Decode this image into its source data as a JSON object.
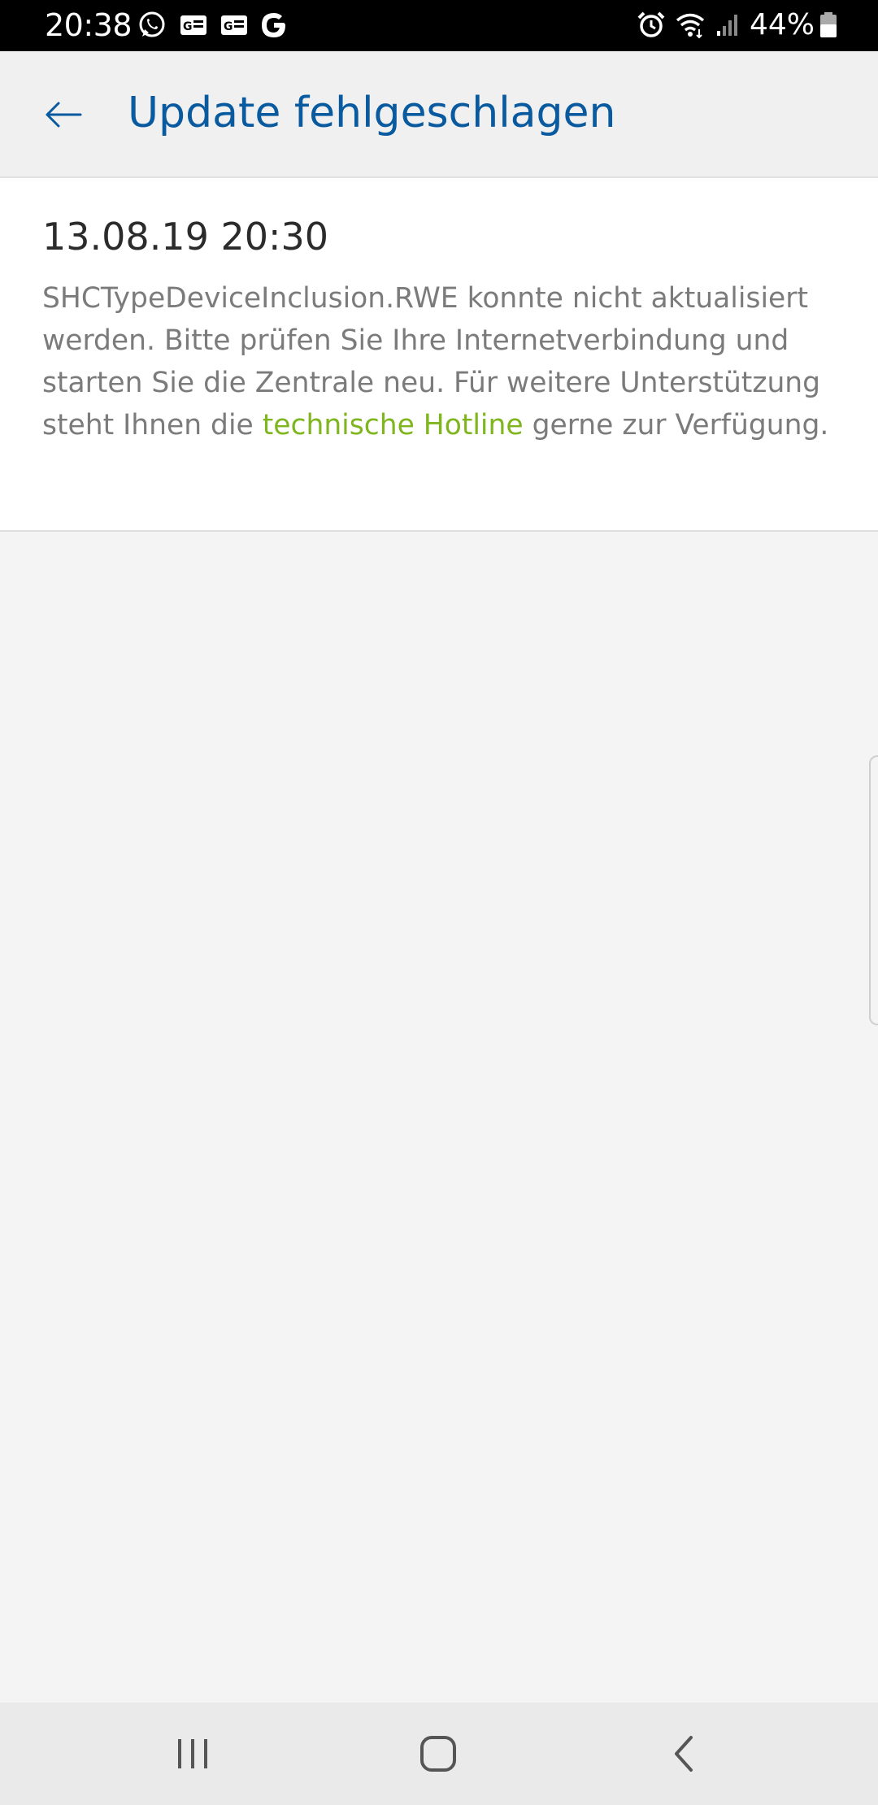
{
  "status_bar": {
    "time": "20:38",
    "battery_percent": "44%",
    "icons": [
      "whatsapp-icon",
      "news-icon",
      "news-icon",
      "google-icon",
      "alarm-icon",
      "wifi-icon",
      "signal-icon",
      "battery-icon"
    ]
  },
  "header": {
    "title": "Update fehlgeschlagen"
  },
  "notification": {
    "date": "13.08.19 20:30",
    "message_line_1": "SHCTypeDeviceInclusion.RWE konnte nicht aktualisiert",
    "message_line_2": "werden. Bitte prüfen Sie Ihre Internetverbindung und",
    "message_line_3": "starten Sie die Zentrale neu. Für weitere Unterstützung",
    "message_line_4_prefix": "steht Ihnen die ",
    "hotline_link": "technische Hotline",
    "message_line_4_suffix": " gerne zur Verfügung."
  },
  "colors": {
    "title": "#0a5aa0",
    "link": "#7fb51d",
    "body_text": "#7b7b7b",
    "background": "#f4f4f4"
  },
  "nav_bar": {
    "buttons": [
      "recent-apps",
      "home",
      "back"
    ]
  }
}
